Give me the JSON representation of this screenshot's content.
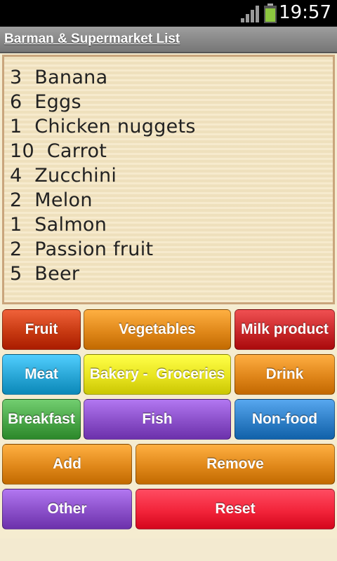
{
  "status": {
    "time": "19:57"
  },
  "app": {
    "title": "Barman & Supermarket List"
  },
  "list": {
    "items": [
      "3  Banana",
      "6  Eggs",
      "1  Chicken nuggets",
      "10  Carrot",
      "4  Zucchini",
      "2  Melon",
      "1  Salmon",
      "2  Passion fruit",
      "5  Beer"
    ]
  },
  "buttons": {
    "fruit": "Fruit",
    "vegetables": "Vegetables",
    "milk_product": "Milk product",
    "meat": "Meat",
    "bakery": "Bakery -  Groceries",
    "drink": "Drink",
    "breakfast": "Breakfast",
    "fish": "Fish",
    "non_food": "Non-food",
    "add": "Add",
    "remove": "Remove",
    "other": "Other",
    "reset": "Reset"
  },
  "colors": {
    "fruit": "#c83a12",
    "vegetables": "#e0881a",
    "milk_product": "#c8282a",
    "meat": "#29a6d6",
    "bakery": "#e8e420",
    "drink": "#e0861a",
    "breakfast": "#4aa648",
    "fish": "#8a4fc9",
    "non_food": "#2f7fc7",
    "add": "#e0881a",
    "remove": "#e0881a",
    "other": "#8a4fc9",
    "reset": "#f2243a"
  }
}
